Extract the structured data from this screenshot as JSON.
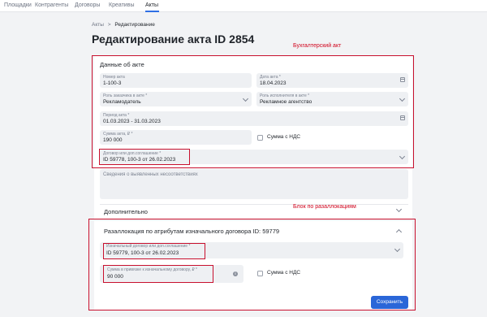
{
  "nav": {
    "tabs": [
      "Площадки",
      "Контрагенты",
      "Договоры",
      "Креативы",
      "Акты"
    ],
    "active_index": 4
  },
  "breadcrumb": {
    "root": "Акты",
    "separator": ">",
    "current": "Редактирование"
  },
  "page_title": "Редактирование акта ID 2854",
  "annotations": {
    "accounting_act": "Бухгалтерский акт",
    "reallocation_block": "Блок по разаллокациям"
  },
  "act_details": {
    "section_title": "Данные об акте",
    "act_number": {
      "label": "Номер акта",
      "value": "1-100-3"
    },
    "act_date": {
      "label": "Дата акта *",
      "value": "18.04.2023"
    },
    "customer_role": {
      "label": "Роль заказчика в акте *",
      "value": "Рекламодатель"
    },
    "contractor_role": {
      "label": "Роль исполнителя в акте *",
      "value": "Рекламное агентство"
    },
    "period": {
      "label": "Период акта *",
      "value": "01.03.2023 - 31.03.2023"
    },
    "amount": {
      "label": "Сумма акта, ₽ *",
      "value": "190 000"
    },
    "vat_checkbox_label": "Сумма с НДС",
    "contract": {
      "label": "Договор или доп.соглашение *",
      "value": "ID 59778, 100-3 от 26.02.2023"
    },
    "discrepancies_placeholder": "Сведения о выявленных несоответствиях"
  },
  "additional": {
    "label": "Дополнительно"
  },
  "reallocation": {
    "title": "Разаллокация по атрибутам изначального договора ID: 59779",
    "original_contract": {
      "label": "Изначальный договор или доп.соглашение *",
      "value": "ID 59779, 100-3 от 26.02.2023"
    },
    "amount": {
      "label": "Сумма в привязке к изначальному договору, ₽ *",
      "value": "90 000"
    },
    "vat_checkbox_label": "Сумма с НДС"
  },
  "save_button": "Сохранить",
  "colors": {
    "accent": "#2a66d8",
    "annotation_red": "#c8102e"
  }
}
